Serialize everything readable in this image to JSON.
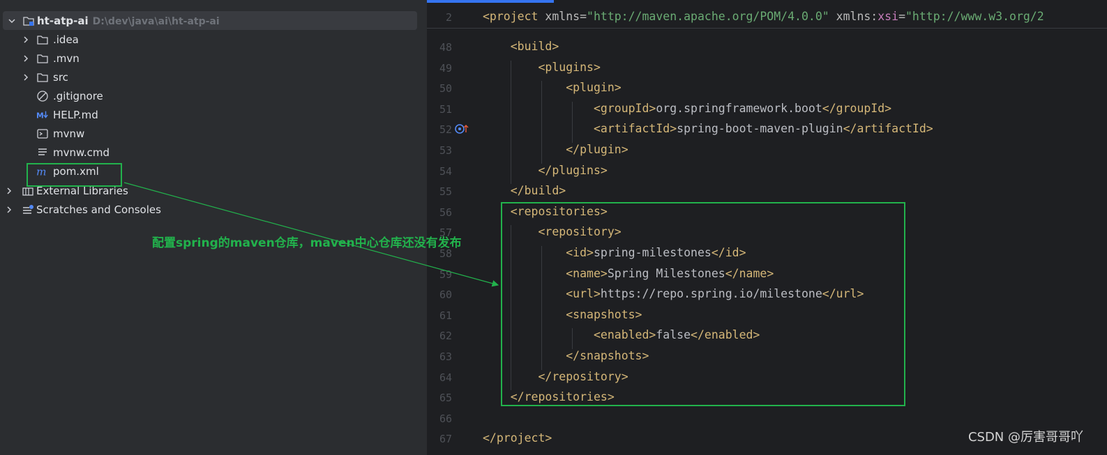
{
  "project_tree": {
    "root": {
      "name": "ht-atp-ai",
      "path": "D:\\dev\\java\\ai\\ht-atp-ai"
    },
    "items": [
      {
        "label": ".idea",
        "icon": "folder-icon"
      },
      {
        "label": ".mvn",
        "icon": "folder-icon"
      },
      {
        "label": "src",
        "icon": "folder-icon"
      },
      {
        "label": ".gitignore",
        "icon": "ignore-file-icon"
      },
      {
        "label": "HELP.md",
        "icon": "markdown-icon"
      },
      {
        "label": "mvnw",
        "icon": "shell-script-icon"
      },
      {
        "label": "mvnw.cmd",
        "icon": "text-file-icon"
      },
      {
        "label": "pom.xml",
        "icon": "maven-icon"
      }
    ],
    "extra": [
      {
        "label": "External Libraries",
        "icon": "library-icon"
      },
      {
        "label": "Scratches and Consoles",
        "icon": "scratches-icon"
      }
    ]
  },
  "editor": {
    "sticky_line": {
      "num": "2",
      "text": "<project xmlns=\"http://maven.apache.org/POM/4.0.0\" xmlns:xsi=\"http://www.w3.org/2"
    },
    "lines": [
      {
        "num": "48",
        "text": "    <build>"
      },
      {
        "num": "49",
        "text": "        <plugins>"
      },
      {
        "num": "50",
        "text": "            <plugin>"
      },
      {
        "num": "51",
        "text": "                <groupId>org.springframework.boot</groupId>"
      },
      {
        "num": "52",
        "text": "                <artifactId>spring-boot-maven-plugin</artifactId>"
      },
      {
        "num": "53",
        "text": "            </plugin>"
      },
      {
        "num": "54",
        "text": "        </plugins>"
      },
      {
        "num": "55",
        "text": "    </build>"
      },
      {
        "num": "56",
        "text": "    <repositories>"
      },
      {
        "num": "57",
        "text": "        <repository>"
      },
      {
        "num": "58",
        "text": "            <id>spring-milestones</id>"
      },
      {
        "num": "59",
        "text": "            <name>Spring Milestones</name>"
      },
      {
        "num": "60",
        "text": "            <url>https://repo.spring.io/milestone</url>"
      },
      {
        "num": "61",
        "text": "            <snapshots>"
      },
      {
        "num": "62",
        "text": "                <enabled>false</enabled>"
      },
      {
        "num": "63",
        "text": "            </snapshots>"
      },
      {
        "num": "64",
        "text": "        </repository>"
      },
      {
        "num": "65",
        "text": "    </repositories>"
      },
      {
        "num": "66",
        "text": ""
      },
      {
        "num": "67",
        "text": "</project>"
      }
    ]
  },
  "annotation": {
    "text": "配置spring的maven仓库，maven中心仓库还没有发布"
  },
  "watermark": {
    "text": "CSDN @厉害哥哥吖"
  },
  "colors": {
    "highlight": "#22b24c",
    "tag": "#d5b778",
    "string": "#6aab73",
    "namespace": "#c77dbb"
  }
}
